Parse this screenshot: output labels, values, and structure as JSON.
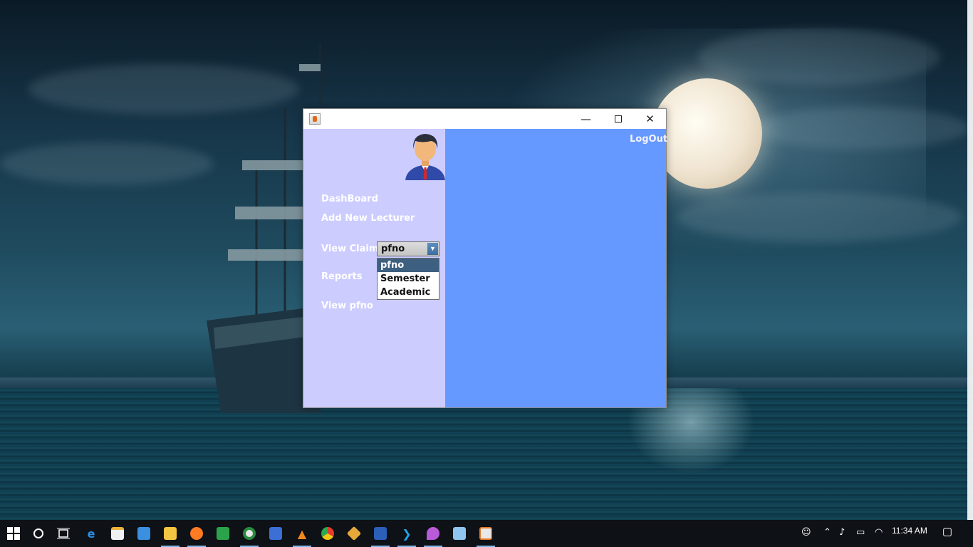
{
  "window": {
    "title": "",
    "controls": {
      "minimize": "—",
      "maximize": "",
      "close": "✕"
    }
  },
  "sidebar": {
    "items": [
      {
        "label": "DashBoard"
      },
      {
        "label": "Add New Lecturer"
      },
      {
        "label": "View Claims"
      },
      {
        "label": "Reports"
      },
      {
        "label": "View pfno"
      }
    ]
  },
  "view_claims_combo": {
    "selected": "pfno",
    "arrow": "▼",
    "options": [
      "pfno",
      "Semester",
      "Academic"
    ]
  },
  "main": {
    "logout_label": "LogOut"
  },
  "taskbar": {
    "time": "11:34 AM",
    "pinned": [
      "windows-start",
      "search",
      "task-view",
      "edge",
      "store",
      "mail",
      "file-explorer",
      "firefox",
      "green-app",
      "circle-app",
      "blue-app",
      "vlc",
      "chrome",
      "git-app",
      "word",
      "vscode",
      "paint-app",
      "cube-app",
      "java-app"
    ],
    "tray": [
      "people-icon",
      "chevron-up-icon",
      "volume-icon",
      "battery-icon",
      "wifi-icon",
      "notification-icon"
    ]
  },
  "colors": {
    "sidebar_bg": "#ccccff",
    "main_bg": "#6699ff",
    "combo_selected_bg": "#3d6080",
    "taskbar_bg": "#0e1116"
  }
}
